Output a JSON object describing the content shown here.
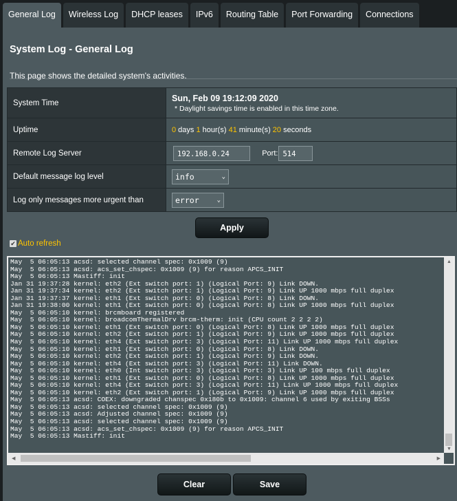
{
  "tabs": [
    {
      "label": "General Log",
      "active": true
    },
    {
      "label": "Wireless Log"
    },
    {
      "label": "DHCP leases"
    },
    {
      "label": "IPv6"
    },
    {
      "label": "Routing Table"
    },
    {
      "label": "Port Forwarding"
    },
    {
      "label": "Connections"
    }
  ],
  "page": {
    "title": "System Log - General Log",
    "description": "This page shows the detailed system's activities."
  },
  "settings": {
    "system_time_label": "System Time",
    "system_time": "Sun, Feb 09 19:12:09 2020",
    "dst_note": "* Daylight savings time is enabled in this time zone.",
    "uptime_label": "Uptime",
    "uptime": {
      "days": "0",
      "days_unit": " days ",
      "hours": "1",
      "hours_unit": " hour(s) ",
      "minutes": "41",
      "minutes_unit": " minute(s) ",
      "seconds": "20",
      "seconds_unit": " seconds"
    },
    "remote_label": "Remote Log Server",
    "remote_ip": "192.168.0.24",
    "port_label": "Port:",
    "port": "514",
    "default_level_label": "Default message log level",
    "default_level": "info",
    "urgent_label": "Log only messages more urgent than",
    "urgent_level": "error"
  },
  "buttons": {
    "apply": "Apply",
    "clear": "Clear",
    "save": "Save"
  },
  "auto_refresh": {
    "label": "Auto refresh",
    "checked": true
  },
  "colors": {
    "accent": "#ffc400",
    "panel": "#4d5a5f"
  },
  "log_lines": [
    "May  5 06:05:13 acsd: selected channel spec: 0x1009 (9)",
    "May  5 06:05:13 acsd: acs_set_chspec: 0x1009 (9) for reason APCS_INIT",
    "May  5 06:05:13 Mastiff: init",
    "Jan 31 19:37:28 kernel: eth2 (Ext switch port: 1) (Logical Port: 9) Link DOWN.",
    "Jan 31 19:37:34 kernel: eth2 (Ext switch port: 1) (Logical Port: 9) Link UP 1000 mbps full duplex",
    "Jan 31 19:37:37 kernel: eth1 (Ext switch port: 0) (Logical Port: 8) Link DOWN.",
    "Jan 31 19:38:00 kernel: eth1 (Ext switch port: 0) (Logical Port: 8) Link UP 1000 mbps full duplex",
    "May  5 06:05:10 kernel: brcmboard registered",
    "May  5 06:05:10 kernel: broadcomThermalDrv brcm-therm: init (CPU count 2 2 2 2)",
    "May  5 06:05:10 kernel: eth1 (Ext switch port: 0) (Logical Port: 8) Link UP 1000 mbps full duplex",
    "May  5 06:05:10 kernel: eth2 (Ext switch port: 1) (Logical Port: 9) Link UP 1000 mbps full duplex",
    "May  5 06:05:10 kernel: eth4 (Ext switch port: 3) (Logical Port: 11) Link UP 1000 mbps full duplex",
    "May  5 06:05:10 kernel: eth1 (Ext switch port: 0) (Logical Port: 8) Link DOWN.",
    "May  5 06:05:10 kernel: eth2 (Ext switch port: 1) (Logical Port: 9) Link DOWN.",
    "May  5 06:05:10 kernel: eth4 (Ext switch port: 3) (Logical Port: 11) Link DOWN.",
    "May  5 06:05:10 kernel: eth0 (Int switch port: 3) (Logical Port: 3) Link UP 100 mbps full duplex",
    "May  5 06:05:10 kernel: eth1 (Ext switch port: 0) (Logical Port: 8) Link UP 1000 mbps full duplex",
    "May  5 06:05:10 kernel: eth4 (Ext switch port: 3) (Logical Port: 11) Link UP 1000 mbps full duplex",
    "May  5 06:05:10 kernel: eth2 (Ext switch port: 1) (Logical Port: 9) Link UP 1000 mbps full duplex",
    "May  5 06:05:13 acsd: COEX: downgraded chanspec 0x180b to 0x1009: channel 6 used by exiting BSSs",
    "May  5 06:05:13 acsd: selected channel spec: 0x1009 (9)",
    "May  5 06:05:13 acsd: Adjusted channel spec: 0x1009 (9)",
    "May  5 06:05:13 acsd: selected channel spec: 0x1009 (9)",
    "May  5 06:05:13 acsd: acs_set_chspec: 0x1009 (9) for reason APCS_INIT",
    "May  5 06:05:13 Mastiff: init"
  ]
}
